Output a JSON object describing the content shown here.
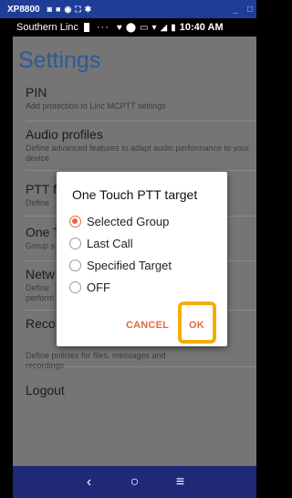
{
  "device_bar": {
    "model": "XP8800",
    "window_controls": [
      "_",
      "□"
    ]
  },
  "status_bar": {
    "carrier": "Southern Linc",
    "dots": "···",
    "time": "10:40 AM"
  },
  "app": {
    "title": "Settings"
  },
  "preferences": [
    {
      "title": "PIN",
      "summary": "Add protection to Linc MCPTT settings"
    },
    {
      "title": "Audio profiles",
      "summary": "Define advanced features to adapt audio performance to your device"
    },
    {
      "title": "PTT f",
      "summary": "Define"
    },
    {
      "title": "One T",
      "summary": "Group s"
    },
    {
      "title": "Netw",
      "summary": "Define perform"
    },
    {
      "title": "Reco",
      "summary": "Define policies for files, messages and recordings"
    },
    {
      "title": "Logout",
      "summary": ""
    }
  ],
  "dialog": {
    "title": "One Touch PTT target",
    "options": [
      {
        "label": "Selected Group",
        "selected": true
      },
      {
        "label": "Last Call",
        "selected": false
      },
      {
        "label": "Specified Target",
        "selected": false
      },
      {
        "label": "OFF",
        "selected": false
      }
    ],
    "cancel_label": "CANCEL",
    "ok_label": "OK"
  },
  "nav": {
    "back": "‹",
    "home": "○",
    "recents": "≡"
  },
  "colors": {
    "accent": "#e56a3c",
    "highlight": "#f5ac08",
    "title_blue": "#2b5a9a",
    "nav_bg": "#202878",
    "device_bar_bg": "#1f3d96"
  }
}
